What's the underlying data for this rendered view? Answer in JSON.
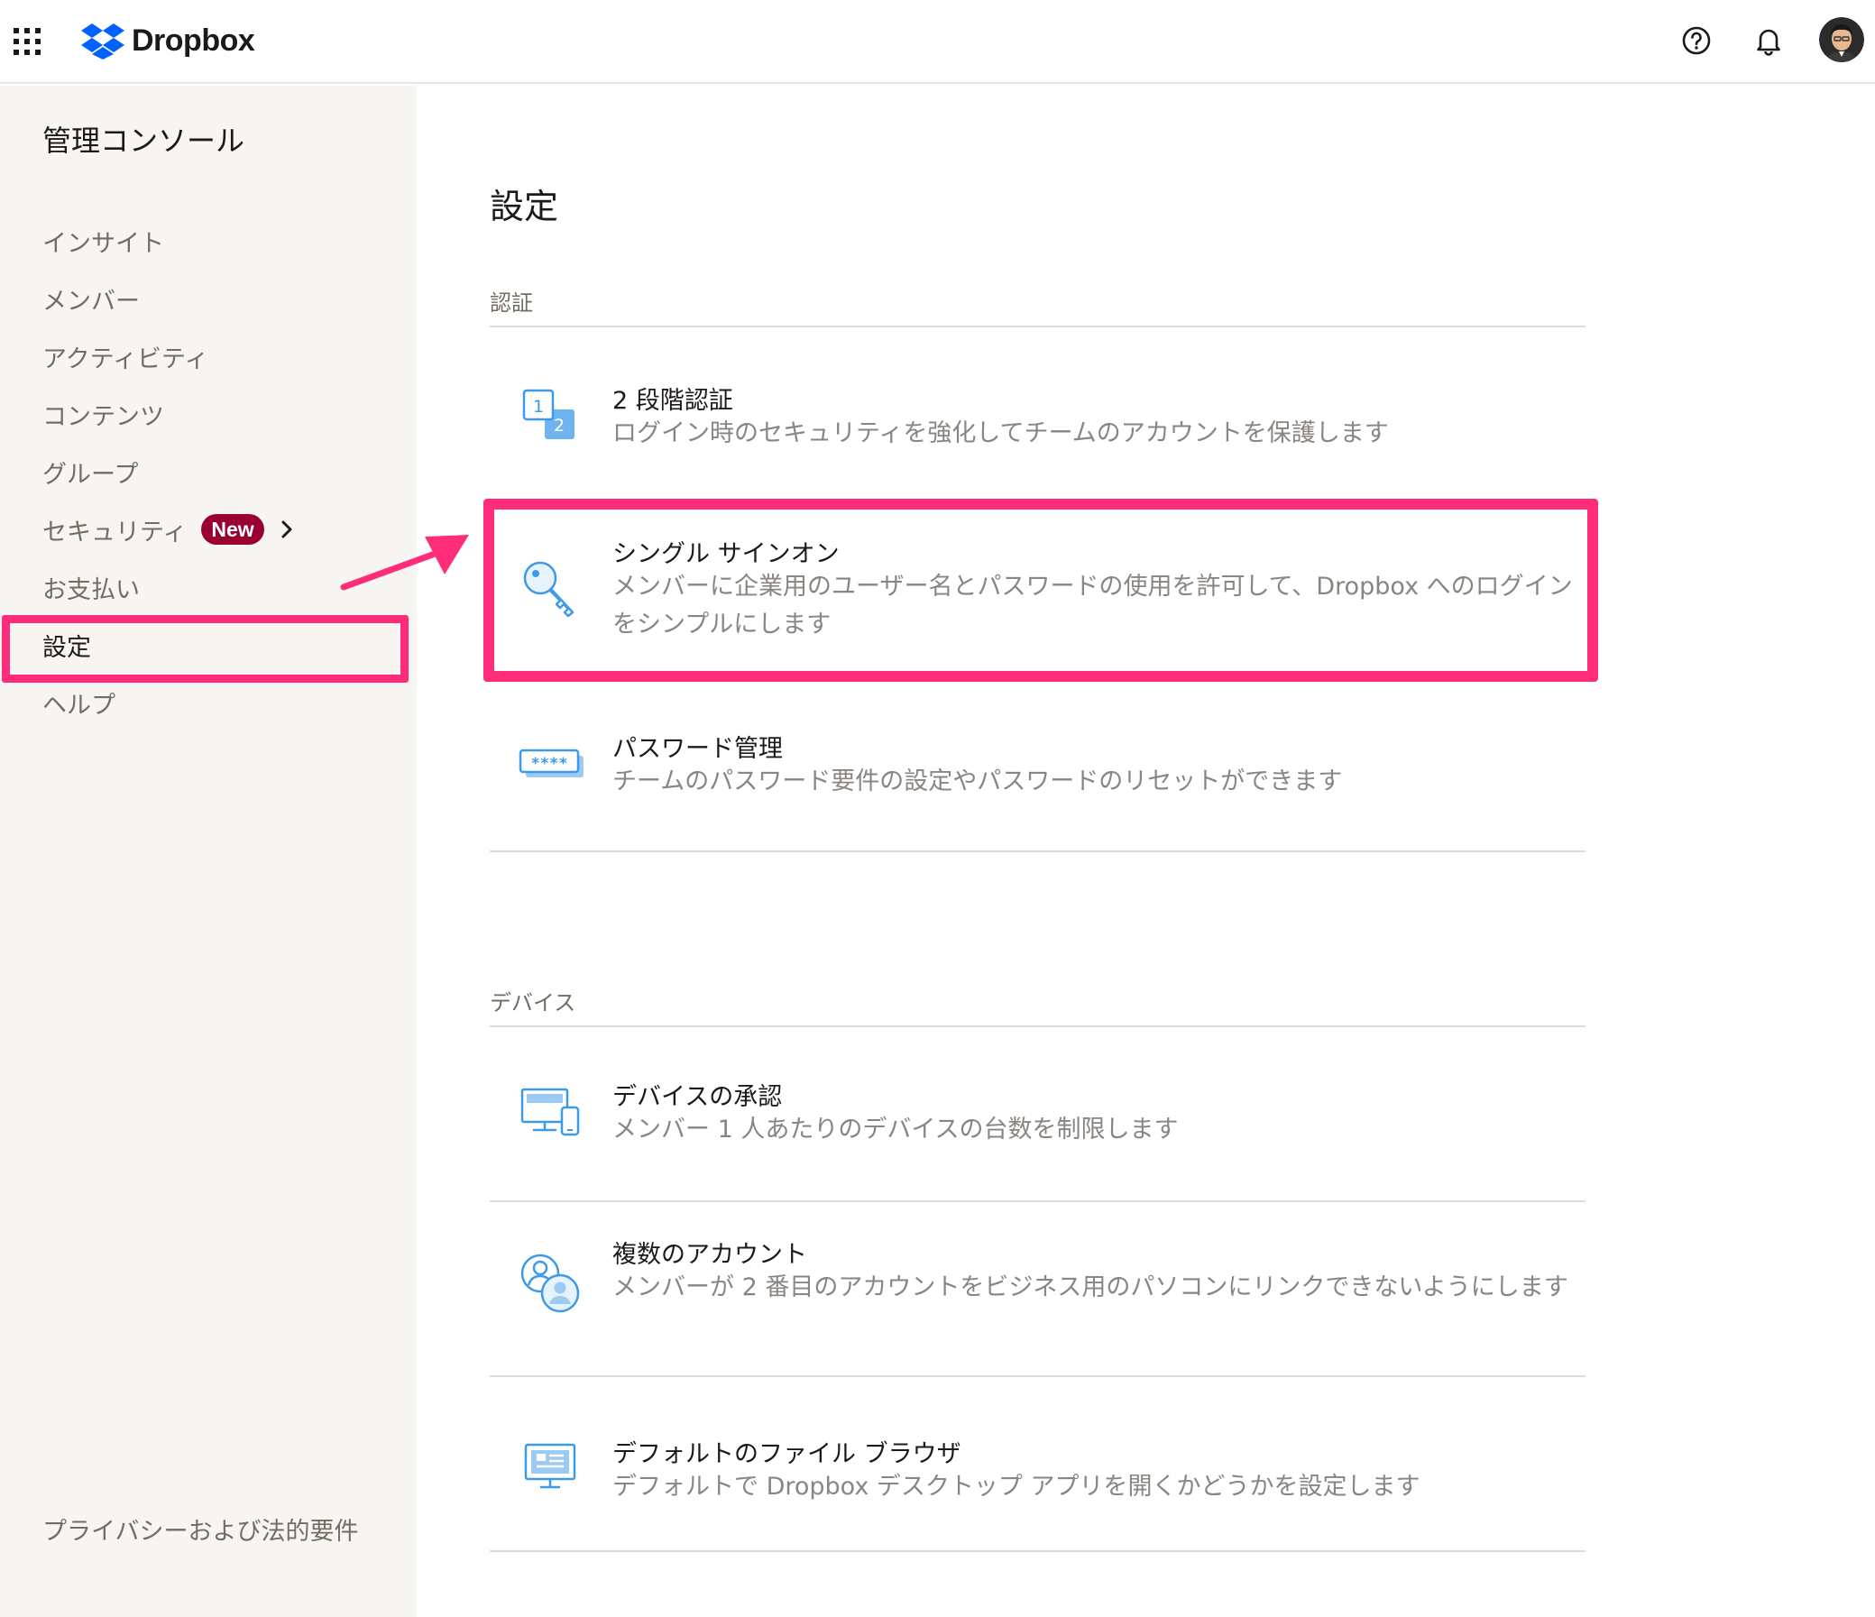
{
  "header": {
    "brand_name": "Dropbox",
    "icons": [
      "apps-grid-icon",
      "dropbox-logo-icon",
      "help-icon",
      "bell-icon",
      "avatar"
    ]
  },
  "sidebar": {
    "title": "管理コンソール",
    "items": [
      {
        "label": "インサイト"
      },
      {
        "label": "メンバー"
      },
      {
        "label": "アクティビティ"
      },
      {
        "label": "コンテンツ"
      },
      {
        "label": "グループ"
      },
      {
        "label": "セキュリティ",
        "badge": "New"
      },
      {
        "label": "お支払い"
      },
      {
        "label": "設定",
        "active": true
      },
      {
        "label": "ヘルプ"
      }
    ],
    "footer_link": "プライバシーおよび法的要件"
  },
  "main": {
    "title": "設定",
    "sections": [
      {
        "label": "認証",
        "rows": [
          {
            "title": "2 段階認証",
            "desc": "ログイン時のセキュリティを強化してチームのアカウントを保護します"
          },
          {
            "title": "シングル サインオン",
            "desc": "メンバーに企業用のユーザー名とパスワードの使用を許可して、Dropbox へのログインをシンプルにします"
          },
          {
            "title": "パスワード管理",
            "desc": "チームのパスワード要件の設定やパスワードのリセットができます"
          }
        ]
      },
      {
        "label": "デバイス",
        "rows": [
          {
            "title": "デバイスの承認",
            "desc": "メンバー 1 人あたりのデバイスの台数を制限します"
          },
          {
            "title": "複数のアカウント",
            "desc": "メンバーが 2 番目のアカウントをビジネス用のパソコンにリンクできないようにします"
          },
          {
            "title": "デフォルトのファイル ブラウザ",
            "desc": "デフォルトで Dropbox デスクトップ アプリを開くかどうかを設定します"
          }
        ]
      }
    ]
  },
  "icon_text": {
    "two_step_1": "1",
    "two_step_2": "2",
    "password_mask": "****"
  },
  "colors": {
    "accent_blue": "#0061fe",
    "icon_blue": "#3d9ae8",
    "highlight_pink": "#ff2c7a",
    "badge_red": "#9b0032",
    "sidebar_bg": "#f7f5f2"
  }
}
